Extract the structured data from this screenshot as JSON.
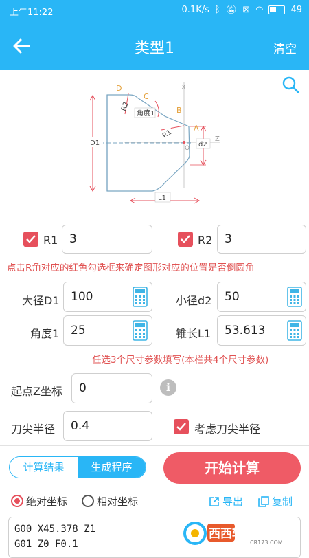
{
  "status": {
    "time": "上午11:22",
    "network": "0.1K/s",
    "battery": "49"
  },
  "appbar": {
    "title": "类型1",
    "clear_label": "清空"
  },
  "diagram": {
    "point_labels": [
      "D",
      "C",
      "B",
      "A",
      "O"
    ],
    "axis_labels": [
      "X",
      "Z"
    ],
    "dim_labels": {
      "d1": "D1",
      "d2": "d2",
      "l1": "L1",
      "r1": "R1",
      "r2": "R2",
      "angle": "角度1"
    }
  },
  "radius": {
    "r1": {
      "label": "R1",
      "value": "3",
      "checked": true
    },
    "r2": {
      "label": "R2",
      "value": "3",
      "checked": true
    },
    "note": "点击R角对应的红色勾选框来确定图形对应的位置是否倒圆角"
  },
  "params": {
    "large_diameter": {
      "label": "大径D1",
      "value": "100"
    },
    "small_diameter": {
      "label": "小径d2",
      "value": "50"
    },
    "angle": {
      "label": "角度1",
      "value": "25"
    },
    "taper_length": {
      "label": "锥长L1",
      "value": "53.613"
    },
    "note": "任选3个尺寸参数填写(本栏共4个尺寸参数)"
  },
  "start_z": {
    "label": "起点Z坐标",
    "value": "0"
  },
  "tip": {
    "label": "刀尖半径",
    "value": "0.4",
    "consider_label": "考虑刀尖半径",
    "consider_checked": true
  },
  "tabs": {
    "result": "计算结果",
    "program": "生成程序",
    "active": "program"
  },
  "start_button": "开始计算",
  "coords": {
    "absolute": "绝对坐标",
    "relative": "相对坐标",
    "selected": "absolute"
  },
  "actions": {
    "export": "导出",
    "copy": "复制"
  },
  "output_lines": [
    "G00 X45.378 Z1",
    "G01 Z0 F0.1"
  ],
  "watermark": {
    "text": "西西软件园",
    "sub": "CR173.COM"
  },
  "colors": {
    "primary": "#29b6f6",
    "accent": "#e6505c",
    "button": "#ef5b66"
  }
}
